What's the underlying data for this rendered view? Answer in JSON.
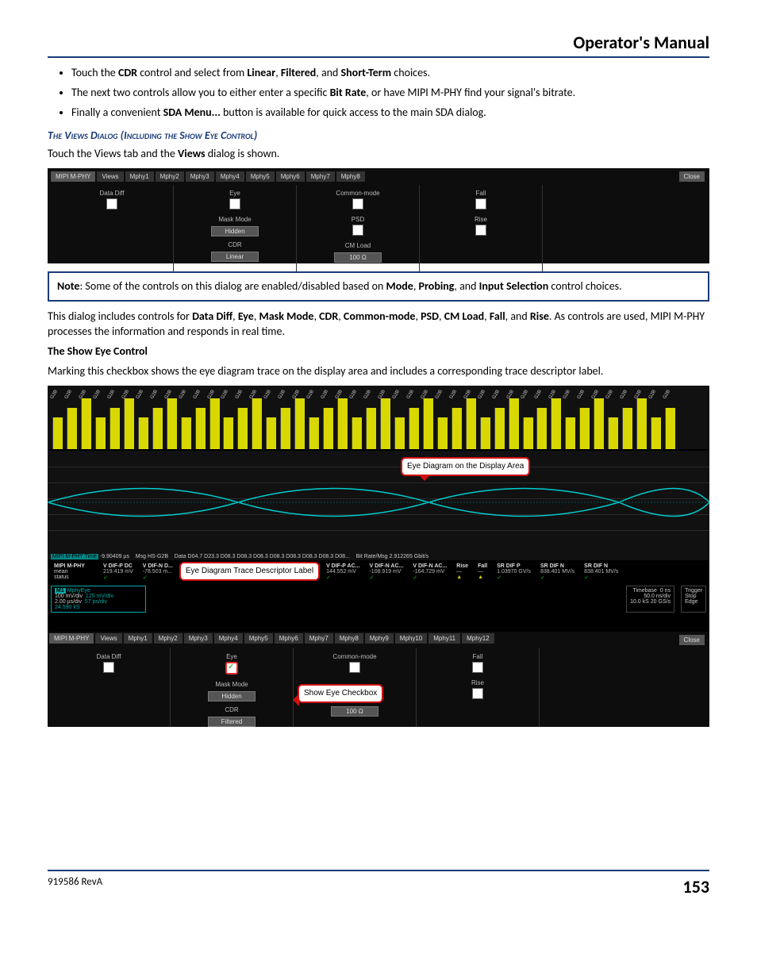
{
  "header": {
    "title": "Operator's Manual"
  },
  "bullets": [
    {
      "pre": "Touch the ",
      "b1": "CDR",
      "mid1": " control and select from ",
      "b2": "Linear",
      "mid2": ", ",
      "b3": "Filtered",
      "mid3": ", and ",
      "b4": "Short-Term",
      "post": " choices."
    },
    {
      "pre": "The next two controls allow you to either enter a specific ",
      "b1": "Bit Rate",
      "post": ", or have MIPI M-PHY find your signal's bitrate."
    },
    {
      "pre": "Finally a convenient ",
      "b1": "SDA Menu...",
      "post": " button is available for quick access to the main SDA dialog."
    }
  ],
  "sectionHeading": "The Views Dialog (Including the Show Eye Control)",
  "viewsIntro": {
    "pre": "Touch the Views tab and the ",
    "b": "Views",
    "post": " dialog is shown."
  },
  "ss1": {
    "tabs": [
      "MIPI M-PHY",
      "Views",
      "Mphy1",
      "Mphy2",
      "Mphy3",
      "Mphy4",
      "Mphy5",
      "Mphy6",
      "Mphy7",
      "Mphy8"
    ],
    "close": "Close",
    "col1": {
      "dataDiff": "Data Diff"
    },
    "col2": {
      "eye": "Eye",
      "maskMode": "Mask Mode",
      "maskVal": "Hidden",
      "cdr": "CDR",
      "cdrVal": "Linear"
    },
    "col3": {
      "common": "Common-mode",
      "psd": "PSD",
      "cmload": "CM Load",
      "cmloadVal": "100 Ω"
    },
    "col4": {
      "fall": "Fall",
      "rise": "Rise"
    }
  },
  "note": {
    "label": "Note",
    "pre": ": Some of the controls on this dialog are enabled/disabled based on ",
    "b1": "Mode",
    "c1": ", ",
    "b2": "Probing",
    "c2": ", and ",
    "b3": "Input Selection",
    "post": " control choices."
  },
  "para1": {
    "pre": "This dialog includes controls for ",
    "items": [
      "Data Diff",
      "Eye",
      "Mask Mode",
      "CDR",
      "Common-mode",
      "PSD",
      "CM Load",
      "Fall",
      "Rise"
    ],
    "post": ". As controls are used, MIPI M-PHY processes the information and responds in real time."
  },
  "showEyeHeading": "The Show Eye Control",
  "para2": "Marking this checkbox shows the eye diagram trace on the display area and includes a corresponding trace descriptor label.",
  "ss2": {
    "waveLabel": "G2B",
    "callout1": "Eye Diagram on\nthe Display Area",
    "callout2": "Eye Diagram\nTrace Descriptor\nLabel",
    "callout3": "Show Eye Checkbox",
    "sda": {
      "left": "MIPI M-PHY Time",
      "leftVal": "-9.90409 µs",
      "msg": "Msg",
      "msgVal": "HS-G2B",
      "data": "Data",
      "dataVal": "D04.7 D23.3 D08.3 D08.3 D08.3 D08.3 D08.3 D08.3 D08.3 D08...",
      "bitrate": "Bit Rate/Msg",
      "bitrateVal": "2.912265 Gbit/s"
    },
    "meas": {
      "row0": "MIPI M-PHY",
      "mean": "mean",
      "status": "status",
      "c1": {
        "h": "V DIF-P DC",
        "v": "219.419 mV"
      },
      "c2": {
        "h": "V DIF-N D...",
        "v": "-78.503 m..."
      },
      "c3": {
        "h": "...C...",
        "v": "... mV"
      },
      "c4": {
        "h": "V DIF-P AC...",
        "v": "144.552 mV"
      },
      "c5": {
        "h": "V DIF-N AC...",
        "v": "-108.919 mV"
      },
      "c6": {
        "h": "V DIF-N AC...",
        "v": "-164.729 mV"
      },
      "cr": {
        "h": "Rise",
        "v": "—"
      },
      "cf": {
        "h": "Fall",
        "v": "—"
      },
      "c7": {
        "h": "SR DIF P",
        "v": "1.03970 GV/s"
      },
      "c8": {
        "h": "SR DIF N",
        "v": "838.401 MV/s"
      },
      "c9": {
        "h": "SR DIF N",
        "v": "838.401 MV/s"
      },
      "m1": "M1",
      "m1name": "MphyEye",
      "m1a": "100 mV/div",
      "m1b": "2.00 µs/div",
      "m1c": "125 mV/div",
      "m1d": "57 ps/div",
      "m1e": "24.590 kS",
      "tbase": {
        "h": "Timebase",
        "a": "0 ns",
        "b": "50.0 ns/div",
        "c": "10.0 kS",
        "d": "20 GS/s"
      },
      "trig": {
        "h": "Trigger",
        "a": "Stop",
        "b": "Edge"
      }
    },
    "tabs2": [
      "MIPI M-PHY",
      "Views",
      "Mphy1",
      "Mphy2",
      "Mphy3",
      "Mphy4",
      "Mphy5",
      "Mphy6",
      "Mphy7",
      "Mphy8",
      "Mphy9",
      "Mphy10",
      "Mphy11",
      "Mphy12"
    ],
    "close2": "Close",
    "col1": {
      "dataDiff": "Data Diff"
    },
    "col2": {
      "eye": "Eye",
      "maskMode": "Mask Mode",
      "maskVal": "Hidden",
      "cdr": "CDR",
      "cdrVal": "Filtered"
    },
    "col3": {
      "common": "Common-mode",
      "cmloadVal": "100 Ω"
    },
    "col4": {
      "fall": "Fall",
      "rise": "Rise"
    }
  },
  "footer": {
    "left": "919586 RevA",
    "page": "153"
  }
}
